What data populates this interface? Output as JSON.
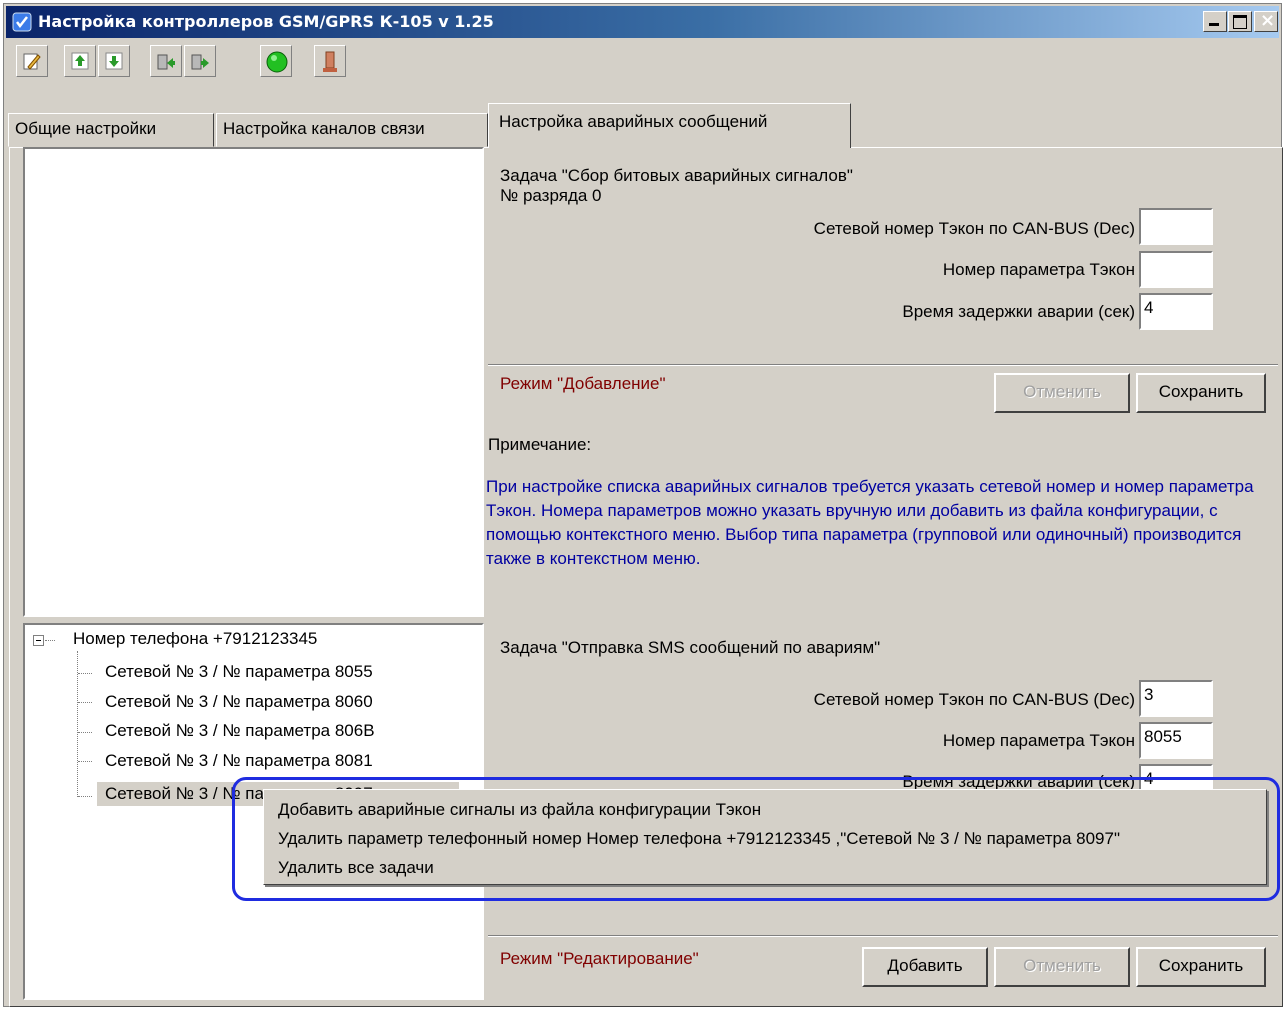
{
  "window": {
    "title": "Настройка контроллеров GSM/GPRS К-105   v 1.25",
    "controls": {
      "minimize": "_",
      "maximize": "□",
      "close": "×"
    }
  },
  "toolbar": {
    "icons": [
      "edit-icon",
      "upload-icon",
      "download-icon",
      "import-icon",
      "export-icon",
      "connect-icon",
      "disconnect-icon"
    ]
  },
  "tabs": [
    "Общие настройки",
    "Настройка каналов связи",
    "Настройка аварийных сообщений"
  ],
  "top_task": {
    "title": "Задача \"Сбор битовых аварийных сигналов\"",
    "bit": "№ разряда 0",
    "label_network": "Сетевой номер Тэкон по CAN-BUS  (Dec)",
    "value_network": "",
    "label_param": "Номер параметра Тэкон",
    "value_param": "",
    "label_delay": "Время задержки аварии (сек)",
    "value_delay": "4",
    "mode": "Режим \"Добавление\"",
    "cancel_label": "Отменить",
    "save_label": "Сохранить",
    "note_title": "Примечание:",
    "note_text": "При настройке списка аварийных сигналов требуется указать сетевой номер и номер параметра Тэкон. Номера параметров можно указать вручную или добавить из файла конфигурации, с помощью контекстного меню. Выбор типа параметра (групповой или одиночный) производится также в контекстном меню."
  },
  "tree": {
    "root": "Номер телефона +7912123345",
    "expander": "−",
    "children": [
      "Сетевой №  3 / № параметра  8055",
      "Сетевой №  3 / № параметра  8060",
      "Сетевой №  3 / № параметра  806B",
      "Сетевой №  3 / № параметра  8081",
      "Сетевой №  3 / № параметра  8097"
    ]
  },
  "bottom_task": {
    "title": "Задача \"Отправка SMS сообщений по авариям\"",
    "label_network": "Сетевой номер Тэкон по CAN-BUS  (Dec)",
    "value_network": "3",
    "label_param": "Номер параметра Тэкон",
    "value_param": "8055",
    "label_delay": "Время задержки аварии (сек)",
    "value_delay": "4",
    "mode": "Режим \"Редактирование\"",
    "add_label": "Добавить",
    "cancel_label": "Отменить",
    "save_label": "Сохранить"
  },
  "context_menu": {
    "items": [
      "Добавить аварийные сигналы из файла конфигурации Тэкон",
      "Удалить параметр телефонный номер Номер телефона +7912123345 ,\"Сетевой №  3 / № параметра  8097\"",
      "Удалить все задачи"
    ]
  },
  "colors": {
    "title_start": "#0a246a",
    "title_end": "#a6caf0",
    "note": "#0000a0",
    "mode": "#800000",
    "highlight": "#1f2ce0"
  }
}
